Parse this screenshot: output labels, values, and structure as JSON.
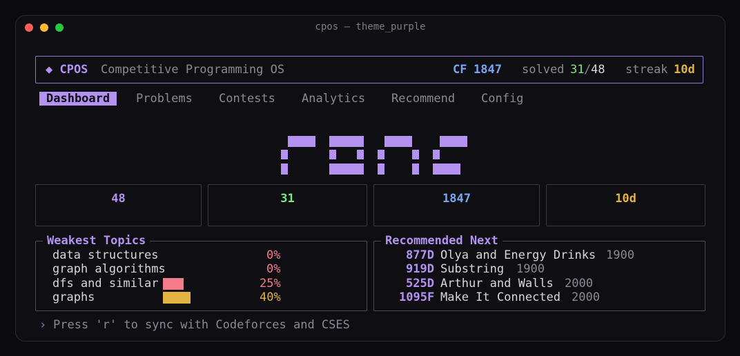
{
  "window": {
    "title": "cpos — theme_purple"
  },
  "header": {
    "brand": "◆ CPOS",
    "subtitle": "Competitive Programming OS",
    "cf_label": "CF",
    "cf_rating": "1847",
    "solved_label": "solved",
    "solved_count": "31",
    "solved_sep": "/",
    "solved_total": "48",
    "streak_label": "streak",
    "streak_value": "10d"
  },
  "tabs": [
    {
      "label": "Dashboard",
      "active": true
    },
    {
      "label": "Problems",
      "active": false
    },
    {
      "label": "Contests",
      "active": false
    },
    {
      "label": "Analytics",
      "active": false
    },
    {
      "label": "Recommend",
      "active": false
    },
    {
      "label": "Config",
      "active": false
    }
  ],
  "stats": [
    {
      "value": "48",
      "color": "#b392f0"
    },
    {
      "value": "31",
      "color": "#7ee787"
    },
    {
      "value": "1847",
      "color": "#79a6f2"
    },
    {
      "value": "10d",
      "color": "#e3b341"
    }
  ],
  "weakest": {
    "title": "Weakest Topics",
    "items": [
      {
        "topic": "data structures",
        "pct": "0%",
        "fraction": 0.0,
        "color": "#f47c8a"
      },
      {
        "topic": "graph algorithms",
        "pct": "0%",
        "fraction": 0.0,
        "color": "#f47c8a"
      },
      {
        "topic": "dfs and similar",
        "pct": "25%",
        "fraction": 0.25,
        "color": "#f47c8a"
      },
      {
        "topic": "graphs",
        "pct": "40%",
        "fraction": 0.4,
        "color": "#e3b341"
      }
    ]
  },
  "recommended": {
    "title": "Recommended Next",
    "items": [
      {
        "id": "877D",
        "name": "Olya and Energy Drinks",
        "rating": "1900"
      },
      {
        "id": "919D",
        "name": "Substring",
        "rating": "1900"
      },
      {
        "id": "525D",
        "name": "Arthur and Walls",
        "rating": "2000"
      },
      {
        "id": "1095F",
        "name": "Make It Connected",
        "rating": "2000"
      }
    ]
  },
  "footer": {
    "prompt": "›",
    "hint": "Press 'r' to sync with Codeforces and CSES"
  },
  "colors": {
    "accent": "#b392f0",
    "green": "#7ee787",
    "blue": "#79a6f2",
    "yellow": "#e3b341",
    "red": "#f47c8a"
  }
}
